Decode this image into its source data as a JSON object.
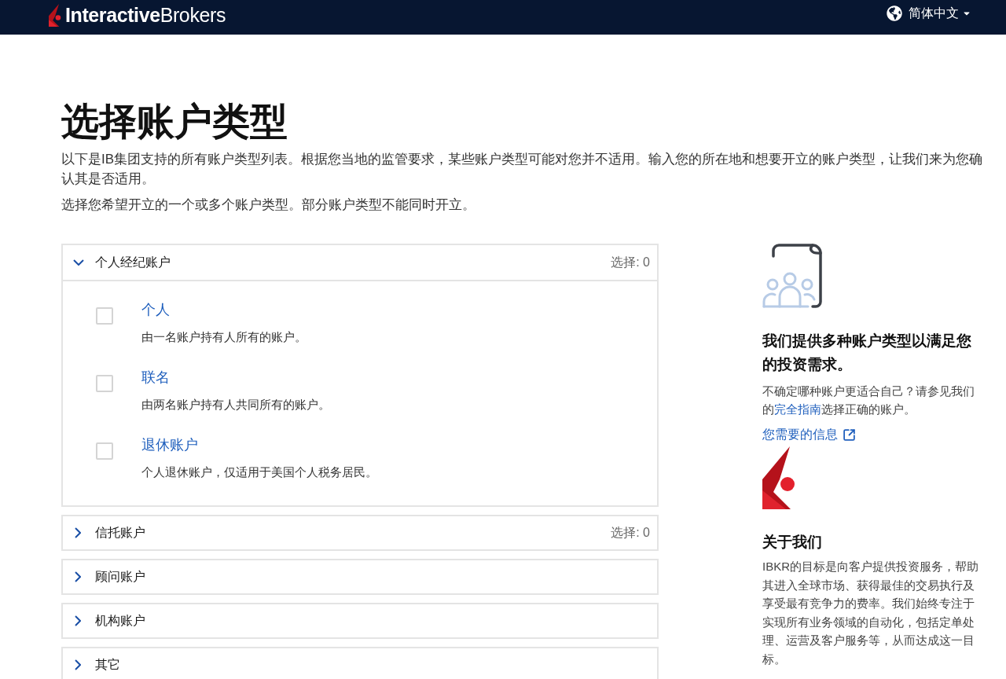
{
  "top_bar": {
    "logo_text": "**Interactive**Brokers",
    "language": "简体中文"
  },
  "page": {
    "title": "选择账户类型",
    "intro": [
      "以下是IB集团支持的所有账户类型列表。根据您当地的监管要求，某些账户类型可能对您并不适用。输入您的所在地和想要开立的账户类型，让我们来为您确认其是否适用。",
      "选择您希望开立的一个或多个账户类型。部分账户类型不能同时开立。"
    ]
  },
  "account_groups": [
    {
      "label": "个人经纪账户",
      "expanded": true,
      "selection": "选择: 0",
      "options": [
        {
          "label": "个人",
          "description": "由一名账户持有人所有的账户。",
          "checked": false
        },
        {
          "label": "联名",
          "description": "由两名账户持有人共同所有的账户。",
          "checked": false
        },
        {
          "label": "退休账户",
          "description": "个人退休账户，仅适用于美国个人税务居民。",
          "checked": false
        }
      ]
    },
    {
      "label": "信托账户",
      "expanded": false,
      "selection": "选择: 0"
    },
    {
      "label": "顾问账户",
      "expanded": false
    },
    {
      "label": "机构账户",
      "expanded": false
    },
    {
      "label": "其它",
      "expanded": false
    }
  ],
  "sidebar": {
    "heading": "我们提供多种账户类型以满足您的投资需求。",
    "guide": {
      "before": "不确定哪种账户更适合自己？请参见我们的",
      "link": "完全指南",
      "after": "选择正确的账户。"
    },
    "info_link": "您需要的信息",
    "about": {
      "heading": "关于我们",
      "text": "IBKR的目标是向客户提供投资服务，帮助其进入全球市场、获得最佳的交易执行及享受最有竞争力的费率。我们始终专注于实现所有业务领域的自动化，包括定单处理、运营及客户服务等，从而达成这一目标。"
    }
  }
}
